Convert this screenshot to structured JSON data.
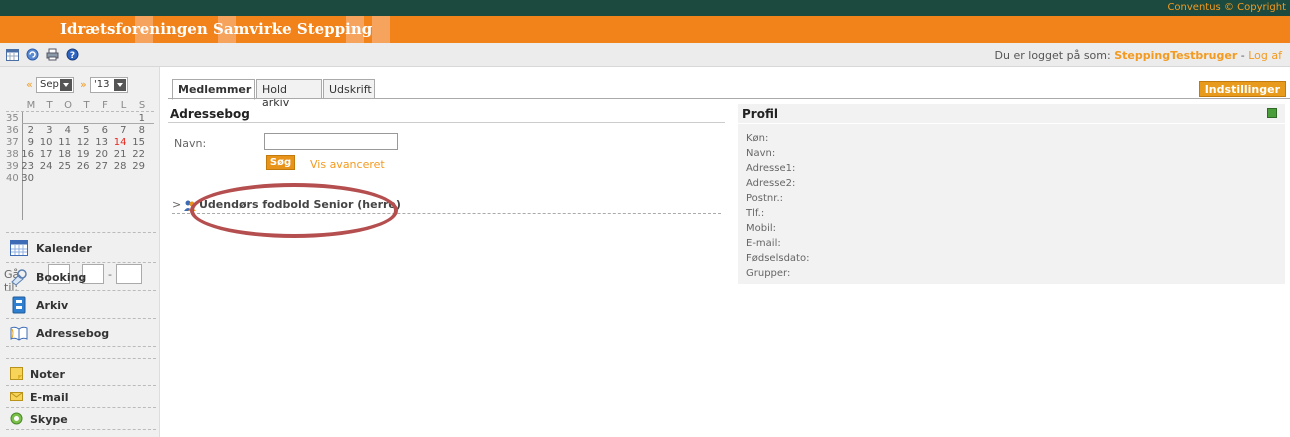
{
  "header": {
    "copyright": "Conventus © Copyright",
    "title": "Idrætsforeningen Samvirke Stepping"
  },
  "toolbar": {
    "icons": [
      "calendar-icon",
      "refresh-icon",
      "print-icon",
      "help-icon"
    ],
    "login_prefix": "Du er logget på som:",
    "username": "SteppingTestbruger",
    "separator": " - ",
    "logout": "Log af"
  },
  "calendar": {
    "prev": "«",
    "next": "»",
    "month": "Sep",
    "year": "'13",
    "day_headers": [
      "M",
      "T",
      "O",
      "T",
      "F",
      "L",
      "S"
    ],
    "weeks": [
      {
        "week": "35",
        "days": [
          "",
          "",
          "",
          "",
          "",
          "",
          "1"
        ]
      },
      {
        "week": "36",
        "days": [
          "2",
          "3",
          "4",
          "5",
          "6",
          "7",
          "8"
        ]
      },
      {
        "week": "37",
        "days": [
          "9",
          "10",
          "11",
          "12",
          "13",
          "14",
          "15"
        ]
      },
      {
        "week": "38",
        "days": [
          "16",
          "17",
          "18",
          "19",
          "20",
          "21",
          "22"
        ]
      },
      {
        "week": "39",
        "days": [
          "23",
          "24",
          "25",
          "26",
          "27",
          "28",
          "29"
        ]
      },
      {
        "week": "40",
        "days": [
          "30",
          "",
          "",
          "",
          "",
          "",
          ""
        ]
      }
    ],
    "highlight_day": "14",
    "goto_label": "Gå til:",
    "goto_sep": "-"
  },
  "nav": {
    "items": [
      {
        "label": "Kalender",
        "icon": "calendar-icon"
      },
      {
        "label": "Booking",
        "icon": "booking-icon"
      },
      {
        "label": "Arkiv",
        "icon": "archive-icon"
      },
      {
        "label": "Adressebog",
        "icon": "addressbook-icon"
      }
    ],
    "small_items": [
      {
        "label": "Noter",
        "icon": "note-icon"
      },
      {
        "label": "E-mail",
        "icon": "email-icon"
      },
      {
        "label": "Skype",
        "icon": "skype-icon"
      }
    ]
  },
  "tabs": [
    "Medlemmer",
    "Hold arkiv",
    "Udskrift"
  ],
  "settings_button": "Indstillinger",
  "addressbook": {
    "title": "Adressebog",
    "name_label": "Navn:",
    "name_value": "",
    "search_button": "Søg",
    "advanced_link": "Vis avanceret",
    "group_chevron": ">",
    "group_label": "Udendørs fodbold Senior (herre)"
  },
  "profile": {
    "title": "Profil",
    "fields": [
      "Køn:",
      "Navn:",
      "Adresse1:",
      "Adresse2:",
      "Postnr.:",
      "Tlf.:",
      "Mobil:",
      "E-mail:",
      "Fødselsdato:",
      "Grupper:"
    ]
  },
  "colors": {
    "header_orange": "#f2831b",
    "top_strip": "#1d4a3e",
    "accent": "#f39a20",
    "annotation_oval": "#b54f4f"
  }
}
